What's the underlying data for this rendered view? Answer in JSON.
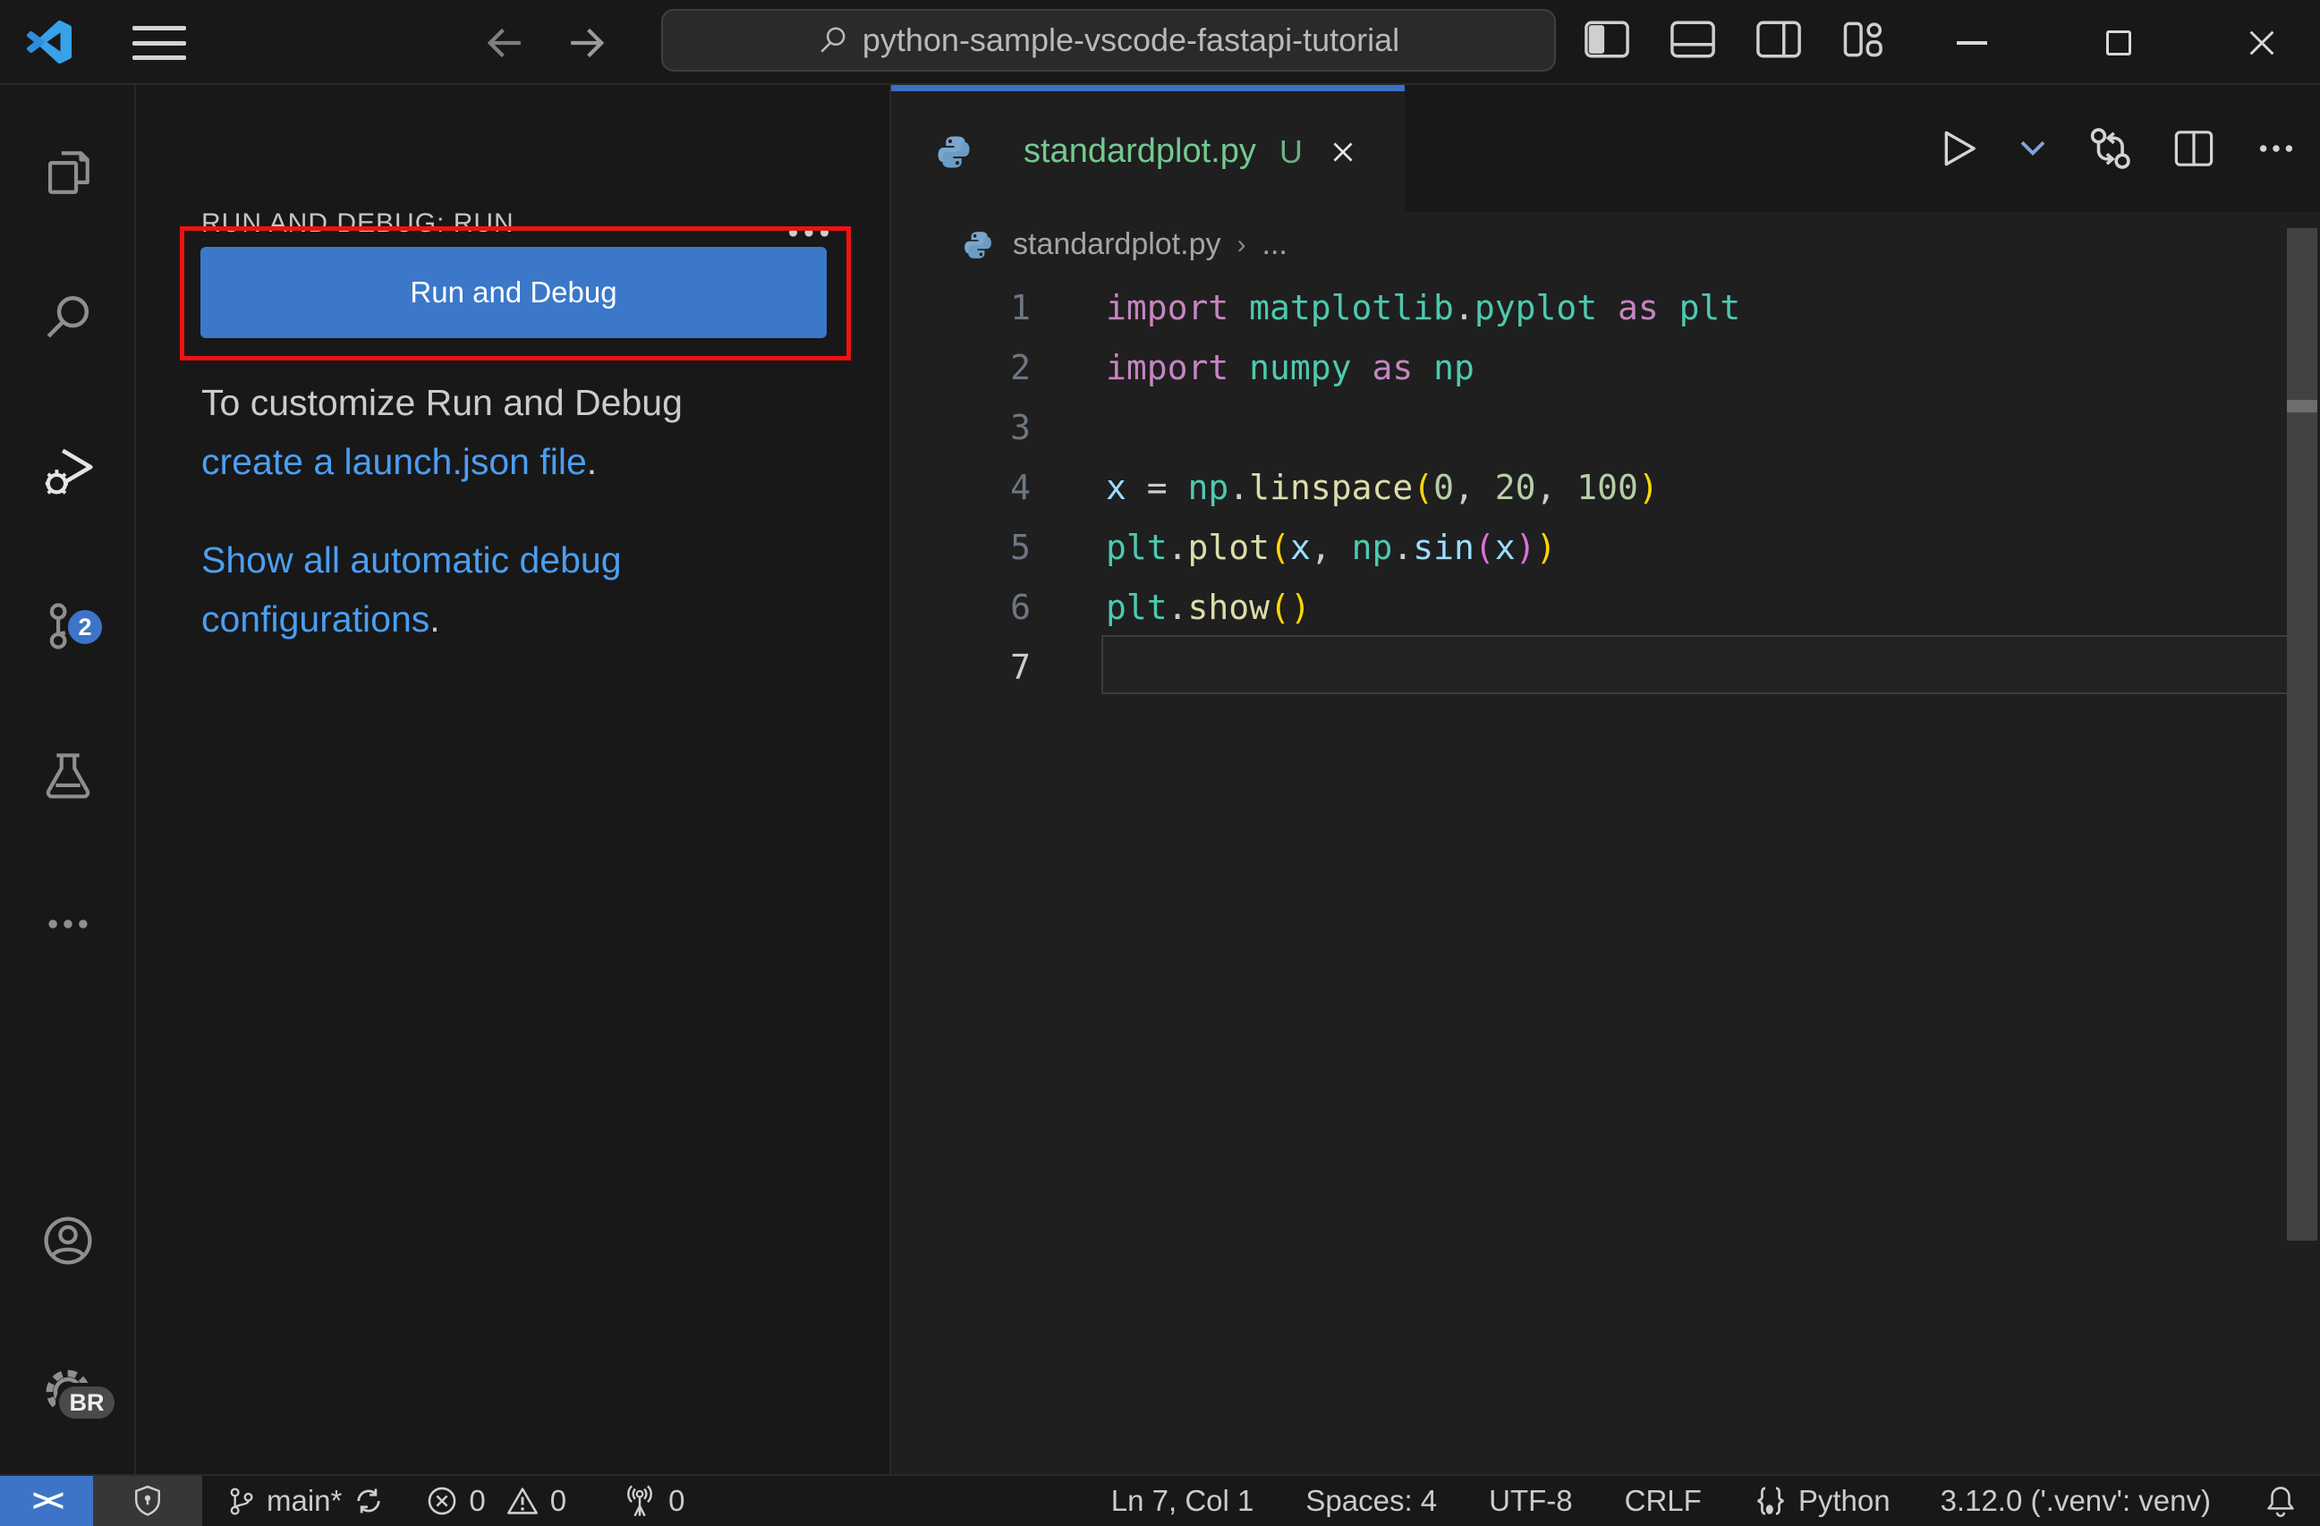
{
  "window": {
    "command_center": "python-sample-vscode-fastapi-tutorial"
  },
  "activity_bar": {
    "scm_badge": "2",
    "gear_badge": "BR"
  },
  "sidebar": {
    "title": "RUN AND DEBUG: RUN",
    "run_button": "Run and Debug",
    "customize_intro": "To customize Run and Debug",
    "customize_link": "create a launch.json file",
    "customize_period": ".",
    "show_link": "Show all automatic debug configurations",
    "show_period": "."
  },
  "editor": {
    "tab": {
      "name": "standardplot.py",
      "dirty": "U"
    },
    "breadcrumb": {
      "file": "standardplot.py",
      "more": "..."
    },
    "code_lines": [
      {
        "n": "1",
        "active": false,
        "tokens": [
          {
            "t": "import ",
            "c": "kw"
          },
          {
            "t": "matplotlib",
            "c": "mod"
          },
          {
            "t": ".",
            "c": "pun"
          },
          {
            "t": "pyplot",
            "c": "mod"
          },
          {
            "t": " ",
            "c": "pun"
          },
          {
            "t": "as",
            "c": "kw"
          },
          {
            "t": " ",
            "c": "pun"
          },
          {
            "t": "plt",
            "c": "mod"
          }
        ]
      },
      {
        "n": "2",
        "active": false,
        "tokens": [
          {
            "t": "import ",
            "c": "kw"
          },
          {
            "t": "numpy",
            "c": "mod"
          },
          {
            "t": " ",
            "c": "pun"
          },
          {
            "t": "as",
            "c": "kw"
          },
          {
            "t": " ",
            "c": "pun"
          },
          {
            "t": "np",
            "c": "mod"
          }
        ]
      },
      {
        "n": "3",
        "active": false,
        "tokens": []
      },
      {
        "n": "4",
        "active": false,
        "tokens": [
          {
            "t": "x",
            "c": "var"
          },
          {
            "t": " = ",
            "c": "pun"
          },
          {
            "t": "np",
            "c": "mod"
          },
          {
            "t": ".",
            "c": "pun"
          },
          {
            "t": "linspace",
            "c": "fn"
          },
          {
            "t": "(",
            "c": "br1"
          },
          {
            "t": "0",
            "c": "num"
          },
          {
            "t": ", ",
            "c": "pun"
          },
          {
            "t": "20",
            "c": "num"
          },
          {
            "t": ", ",
            "c": "pun"
          },
          {
            "t": "100",
            "c": "num"
          },
          {
            "t": ")",
            "c": "br1"
          }
        ]
      },
      {
        "n": "5",
        "active": false,
        "tokens": [
          {
            "t": "plt",
            "c": "mod"
          },
          {
            "t": ".",
            "c": "pun"
          },
          {
            "t": "plot",
            "c": "fn"
          },
          {
            "t": "(",
            "c": "br1"
          },
          {
            "t": "x",
            "c": "var"
          },
          {
            "t": ", ",
            "c": "pun"
          },
          {
            "t": "np",
            "c": "mod"
          },
          {
            "t": ".",
            "c": "pun"
          },
          {
            "t": "sin",
            "c": "var"
          },
          {
            "t": "(",
            "c": "br2"
          },
          {
            "t": "x",
            "c": "var"
          },
          {
            "t": ")",
            "c": "br2"
          },
          {
            "t": ")",
            "c": "br1"
          }
        ]
      },
      {
        "n": "6",
        "active": false,
        "tokens": [
          {
            "t": "plt",
            "c": "mod"
          },
          {
            "t": ".",
            "c": "pun"
          },
          {
            "t": "show",
            "c": "fn"
          },
          {
            "t": "(",
            "c": "br1"
          },
          {
            "t": ")",
            "c": "br1"
          }
        ]
      },
      {
        "n": "7",
        "active": true,
        "tokens": []
      }
    ]
  },
  "status_bar": {
    "remote": "><",
    "branch": "main*",
    "errors": "0",
    "warnings": "0",
    "ports": "0",
    "cursor": "Ln 7, Col 1",
    "indent": "Spaces: 4",
    "encoding": "UTF-8",
    "eol": "CRLF",
    "language": "Python",
    "interpreter": "3.12.0 ('.venv': venv)"
  },
  "colors": {
    "accent_blue": "#3b78ca",
    "badge_blue": "#3d74c8",
    "tab_green": "#73c991",
    "link_blue": "#4b9ef3",
    "highlight_red": "#ee1212"
  }
}
